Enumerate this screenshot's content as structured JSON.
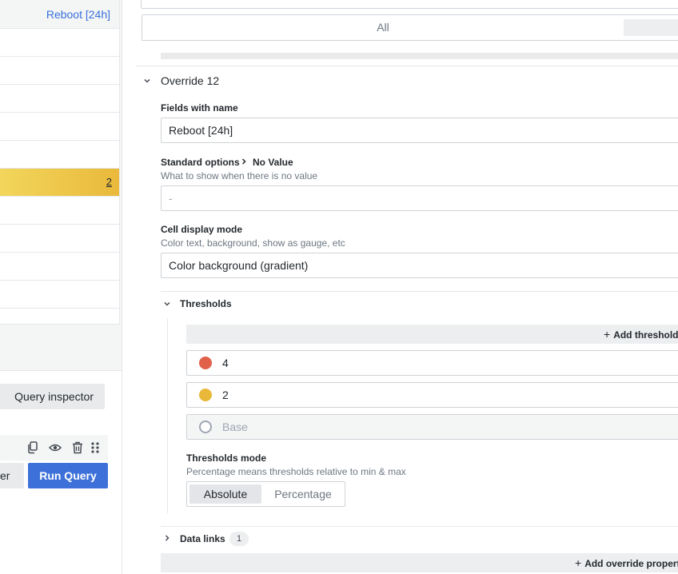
{
  "table": {
    "header": "Reboot [24h]",
    "rows": [
      {
        "value": ""
      },
      {
        "value": ""
      },
      {
        "value": ""
      },
      {
        "value": ""
      },
      {
        "value": ""
      },
      {
        "value": "2"
      },
      {
        "value": ""
      },
      {
        "value": ""
      },
      {
        "value": ""
      },
      {
        "value": ""
      }
    ],
    "highlight_colors": [
      "#f2d65b",
      "#e9b93b"
    ]
  },
  "query": {
    "inspector_label": "Query inspector",
    "partial_button_label": "er",
    "run_label": "Run Query",
    "icons": [
      "copy-icon",
      "eye-icon",
      "trash-icon",
      "drag-handle-icon"
    ],
    "accent_color": "#3d71d9"
  },
  "options": {
    "filter_all": "All",
    "override": {
      "title": "Override 12",
      "fields_label": "Fields with name",
      "fields_value": "Reboot [24h]",
      "std_options_label": "Standard options",
      "std_options_sub": "No Value",
      "std_options_desc": "What to show when there is no value",
      "no_value_placeholder": "-",
      "cell_mode_label": "Cell display mode",
      "cell_mode_desc": "Color text, background, show as gauge, etc",
      "cell_mode_value": "Color background (gradient)",
      "thresholds_title": "Thresholds",
      "add_threshold_label": "Add threshold",
      "thresholds": [
        {
          "value": "4",
          "color": "#e0604a"
        },
        {
          "value": "2",
          "color": "#eab839"
        },
        {
          "value": "Base",
          "color": "none"
        }
      ],
      "thresholds_mode_label": "Thresholds mode",
      "thresholds_mode_desc": "Percentage means thresholds relative to min & max",
      "mode_absolute": "Absolute",
      "mode_percentage": "Percentage",
      "mode_selected": "Absolute",
      "data_links_label": "Data links",
      "data_links_count": "1",
      "add_override_label": "Add override propert"
    }
  }
}
